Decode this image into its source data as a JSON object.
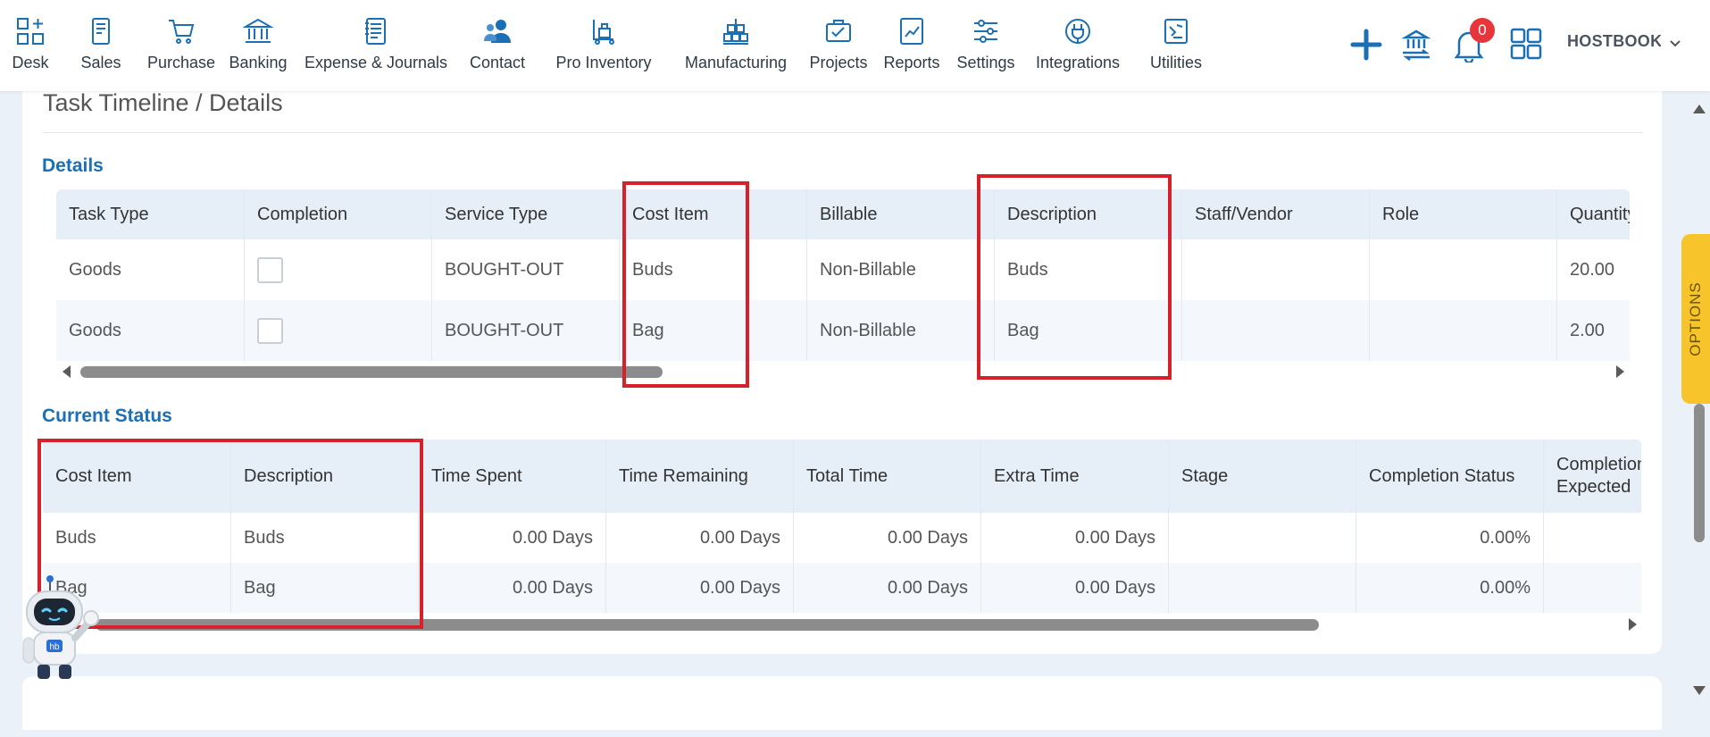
{
  "nav": {
    "items": [
      {
        "key": "desk",
        "label": "Desk",
        "icon": "desk-icon"
      },
      {
        "key": "sales",
        "label": "Sales",
        "icon": "sales-icon"
      },
      {
        "key": "purchase",
        "label": "Purchase",
        "icon": "cart-icon"
      },
      {
        "key": "banking",
        "label": "Banking",
        "icon": "bank-icon"
      },
      {
        "key": "expense",
        "label": "Expense & Journals",
        "icon": "journal-icon"
      },
      {
        "key": "contact",
        "label": "Contact",
        "icon": "contact-icon"
      },
      {
        "key": "inventory",
        "label": "Pro Inventory",
        "icon": "inventory-icon"
      },
      {
        "key": "manufacturing",
        "label": "Manufacturing",
        "icon": "manufacturing-icon"
      },
      {
        "key": "projects",
        "label": "Projects",
        "icon": "projects-icon"
      },
      {
        "key": "reports",
        "label": "Reports",
        "icon": "reports-icon"
      },
      {
        "key": "settings",
        "label": "Settings",
        "icon": "settings-icon"
      },
      {
        "key": "integrations",
        "label": "Integrations",
        "icon": "integrations-icon"
      },
      {
        "key": "utilities",
        "label": "Utilities",
        "icon": "utilities-icon"
      }
    ],
    "notification_count": "0",
    "company": "HOSTBOOKS",
    "accent": "#1b6fb5"
  },
  "page": {
    "title": "Task Timeline / Details"
  },
  "details": {
    "title": "Details",
    "columns": [
      "Task Type",
      "Completion",
      "Service Type",
      "Cost Item",
      "Billable",
      "Description",
      "Staff/Vendor",
      "Role",
      "Quantity"
    ],
    "rows": [
      {
        "task_type": "Goods",
        "service_type": "BOUGHT-OUT",
        "cost_item": "Buds",
        "billable": "Non-Billable",
        "description": "Buds",
        "staff": "",
        "role": "",
        "quantity": "20.00"
      },
      {
        "task_type": "Goods",
        "service_type": "BOUGHT-OUT",
        "cost_item": "Bag",
        "billable": "Non-Billable",
        "description": "Bag",
        "staff": "",
        "role": "",
        "quantity": "2.00"
      }
    ]
  },
  "status": {
    "title": "Current Status",
    "columns": [
      "Cost Item",
      "Description",
      "Time Spent",
      "Time Remaining",
      "Total Time",
      "Extra Time",
      "Stage",
      "Completion Status",
      "Completion Expected"
    ],
    "rows": [
      {
        "cost_item": "Buds",
        "description": "Buds",
        "time_spent": "0.00 Days",
        "time_remaining": "0.00 Days",
        "total_time": "0.00 Days",
        "extra_time": "0.00 Days",
        "stage": "",
        "completion_status": "0.00%",
        "expected": ""
      },
      {
        "cost_item": "Bag",
        "description": "Bag",
        "time_spent": "0.00 Days",
        "time_remaining": "0.00 Days",
        "total_time": "0.00 Days",
        "extra_time": "0.00 Days",
        "stage": "",
        "completion_status": "0.00%",
        "expected": ""
      }
    ]
  },
  "options_label": "OPTIONS",
  "assistant": {
    "badge": "hb"
  }
}
